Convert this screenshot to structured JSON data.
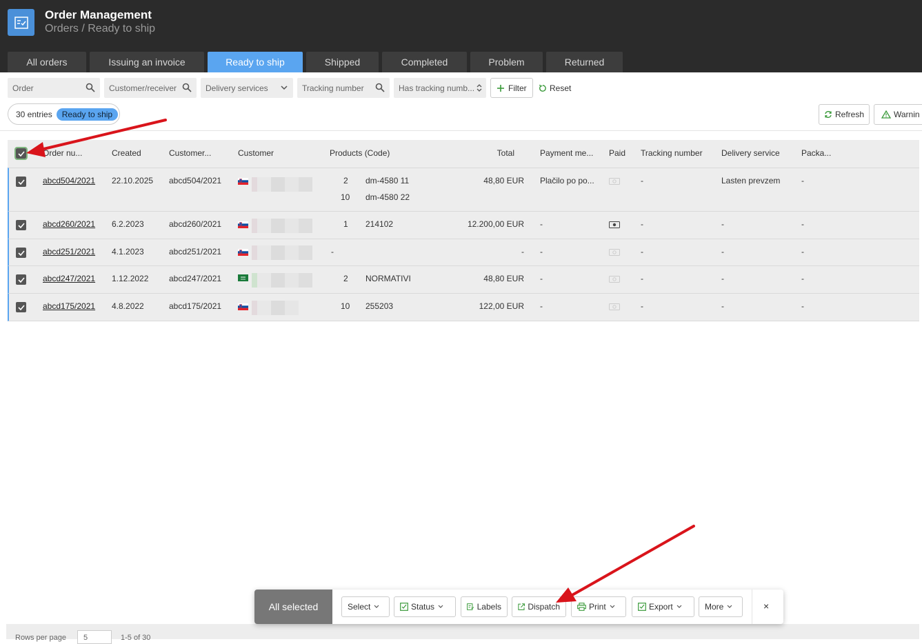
{
  "app": {
    "title": "Order Management",
    "breadcrumb": "Orders / Ready to ship"
  },
  "tabs": [
    {
      "label": "All orders",
      "active": false
    },
    {
      "label": "Issuing an invoice",
      "active": false
    },
    {
      "label": "Ready to ship",
      "active": true
    },
    {
      "label": "Shipped",
      "active": false
    },
    {
      "label": "Completed",
      "active": false
    },
    {
      "label": "Problem",
      "active": false
    },
    {
      "label": "Returned",
      "active": false
    }
  ],
  "filters": {
    "order_placeholder": "Order",
    "customer_placeholder": "Customer/receiver",
    "delivery_placeholder": "Delivery services",
    "tracking_placeholder": "Tracking number",
    "has_tracking_placeholder": "Has tracking numb...",
    "filter_label": "Filter",
    "reset_label": "Reset"
  },
  "status_bar": {
    "entries": "30 entries",
    "status": "Ready to ship",
    "refresh_label": "Refresh",
    "warning_label": "Warnin"
  },
  "table": {
    "headers": {
      "order": "Order nu...",
      "created": "Created",
      "customer_num": "Customer...",
      "customer": "Customer",
      "products": "Products (Code)",
      "total": "Total",
      "payment": "Payment me...",
      "paid": "Paid",
      "tracking": "Tracking number",
      "delivery": "Delivery service",
      "package": "Packa..."
    },
    "rows": [
      {
        "order": "abcd504/2021",
        "created": "22.10.2025",
        "customer_num": "abcd504/2021",
        "flag": "SI",
        "qty1": "2",
        "code1": "dm-4580 11",
        "qty2": "10",
        "code2": "dm-4580 22",
        "total": "48,80 EUR",
        "payment": "Plačilo po po...",
        "paid": false,
        "tracking": "-",
        "delivery": "Lasten prevzem",
        "package": "-"
      },
      {
        "order": "abcd260/2021",
        "created": "6.2.2023",
        "customer_num": "abcd260/2021",
        "flag": "SI",
        "qty1": "1",
        "code1": "214102",
        "total": "12.200,00 EUR",
        "payment": "-",
        "paid": true,
        "tracking": "-",
        "delivery": "-",
        "package": "-"
      },
      {
        "order": "abcd251/2021",
        "created": "4.1.2023",
        "customer_num": "abcd251/2021",
        "flag": "SI",
        "qty1": "-",
        "code1": "",
        "total": "-",
        "payment": "-",
        "paid": false,
        "tracking": "-",
        "delivery": "-",
        "package": "-"
      },
      {
        "order": "abcd247/2021",
        "created": "1.12.2022",
        "customer_num": "abcd247/2021",
        "flag": "SA",
        "qty1": "2",
        "code1": "NORMATIVI",
        "total": "48,80 EUR",
        "payment": "-",
        "paid": false,
        "tracking": "-",
        "delivery": "-",
        "package": "-"
      },
      {
        "order": "abcd175/2021",
        "created": "4.8.2022",
        "customer_num": "abcd175/2021",
        "flag": "SI",
        "qty1": "10",
        "code1": "255203",
        "total": "122,00 EUR",
        "payment": "-",
        "paid": false,
        "tracking": "-",
        "delivery": "-",
        "package": "-"
      }
    ]
  },
  "action_bar": {
    "label": "All selected",
    "select": "Select",
    "status": "Status",
    "labels": "Labels",
    "dispatch": "Dispatch",
    "print": "Print",
    "export": "Export",
    "more": "More",
    "close": "×"
  },
  "footer": {
    "rows_per_page": "Rows per page",
    "rows_value": "5",
    "range": "1-5 of 30"
  },
  "colors": {
    "accent": "#5aa5f0",
    "header_bg": "#2b2b2b",
    "arrow": "#d9141b"
  }
}
